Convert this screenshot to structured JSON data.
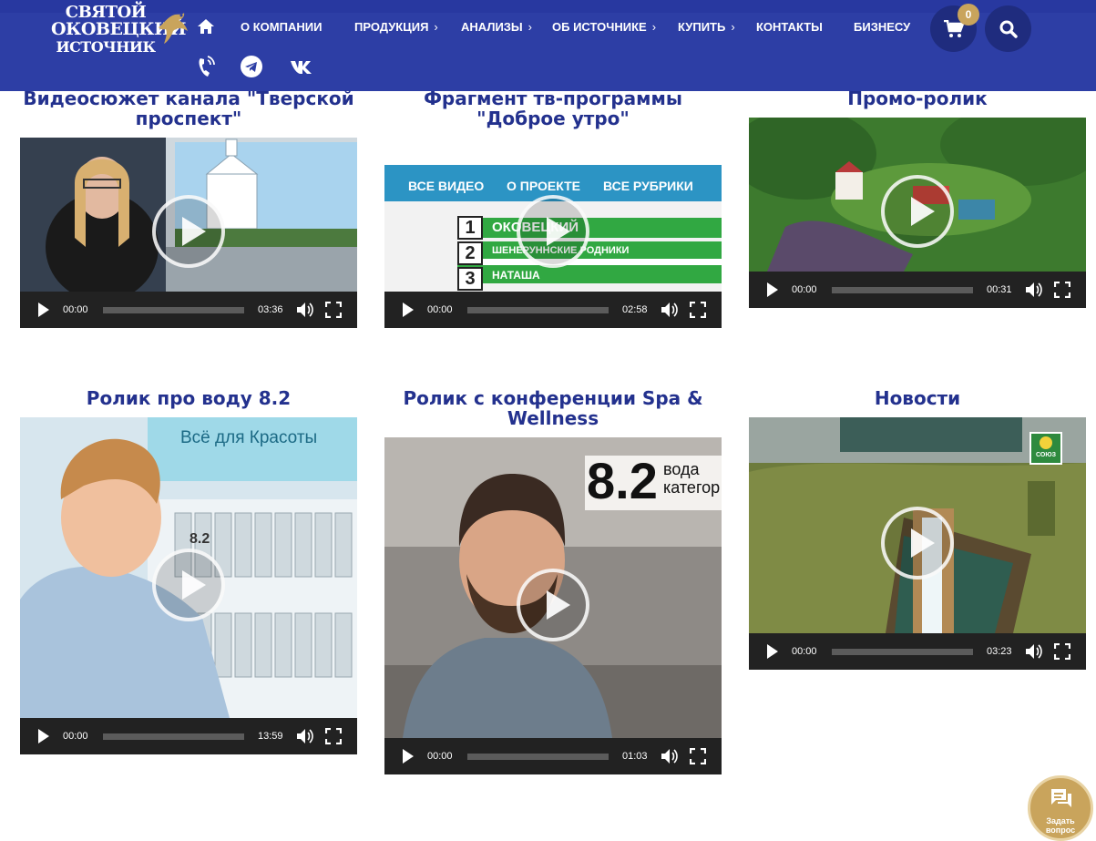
{
  "header": {
    "logo": {
      "line1": "СВЯТОЙ",
      "line2": "ОКОВЕЦКИЙ",
      "line3": "ИСТОЧНИК",
      "icon": "bird-logo-icon"
    },
    "nav": [
      {
        "label": "О КОМПАНИИ",
        "has_submenu": false
      },
      {
        "label": "ПРОДУКЦИЯ",
        "has_submenu": true
      },
      {
        "label": "АНАЛИЗЫ",
        "has_submenu": true
      },
      {
        "label": "ОБ ИСТОЧНИКЕ",
        "has_submenu": true
      },
      {
        "label": "КУПИТЬ",
        "has_submenu": true
      },
      {
        "label": "КОНТАКТЫ",
        "has_submenu": false
      },
      {
        "label": "БИЗНЕСУ",
        "has_submenu": false
      }
    ],
    "cart_count": "0",
    "social": [
      "phone-icon",
      "telegram-icon",
      "vk-icon"
    ]
  },
  "colors": {
    "header_bg": "#2d3ea5",
    "title": "#23318e",
    "accent_gold": "#c9a45c",
    "player_bar": "#222222"
  },
  "videos": [
    {
      "title": "Видеосюжет канала \"Тверской проспект\"",
      "current": "00:00",
      "duration": "03:36"
    },
    {
      "title": "Фрагмент тв-программы \"Доброе утро\"",
      "current": "00:00",
      "duration": "02:58"
    },
    {
      "title": "Промо-ролик",
      "current": "00:00",
      "duration": "00:31"
    },
    {
      "title": "Ролик про воду 8.2",
      "current": "00:00",
      "duration": "13:59"
    },
    {
      "title": "Ролик с конференции Spa & Wellness",
      "current": "00:00",
      "duration": "01:03"
    },
    {
      "title": "Новости",
      "current": "00:00",
      "duration": "03:23"
    }
  ],
  "thumb_text": {
    "v2_menu": [
      "ВСЕ ВИДЕО",
      "О ПРОЕКТЕ",
      "ВСЕ РУБРИКИ"
    ],
    "v2_rows": [
      {
        "num": "1",
        "text": "ОКОВЕЦКИЙ"
      },
      {
        "num": "2",
        "text": "ШЕНЕРУННСКИЕ РОДНИКИ"
      },
      {
        "num": "3",
        "text": "НАТАША"
      }
    ],
    "v4_sign": "Всё для Красоты",
    "v4_bottle": "8.2",
    "v5_sign_big": "8.2",
    "v5_sign_small1": "вода",
    "v5_sign_small2": "категор",
    "v6_logo": "СОЮЗ"
  },
  "chat": {
    "label_line1": "Задать",
    "label_line2": "вопрос",
    "icon": "chat-bubbles-icon"
  }
}
